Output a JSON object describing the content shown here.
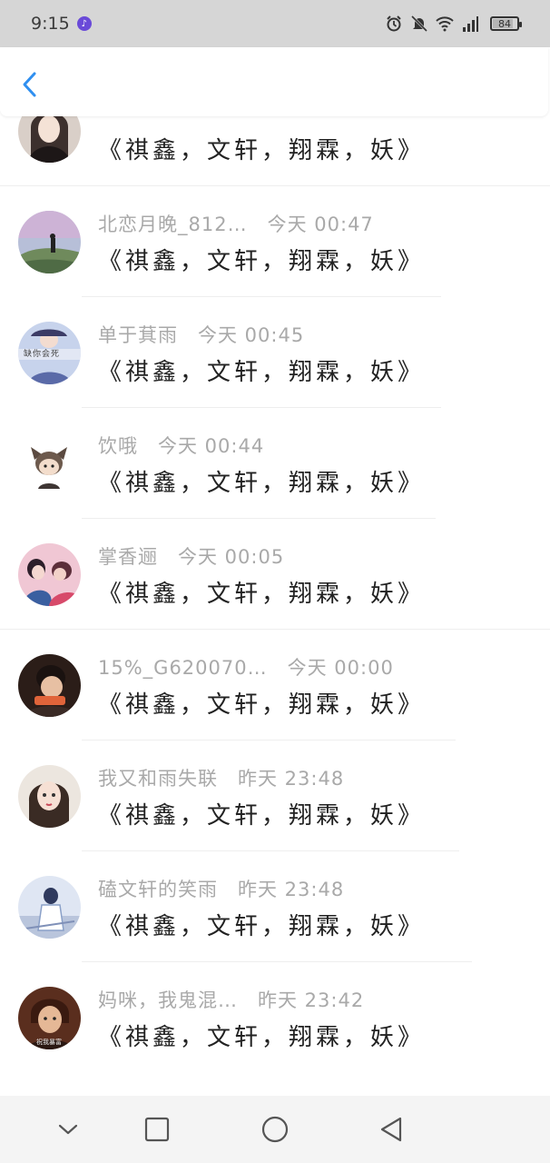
{
  "status_bar": {
    "time": "9:15",
    "battery": "84",
    "battery_level": 0.84,
    "icons": [
      "music-icon",
      "alarm-icon",
      "mute-icon",
      "wifi-icon",
      "signal-icon",
      "battery-icon"
    ]
  },
  "header": {
    "back_icon": "chevron-left-icon",
    "accent": "#2f8ff0"
  },
  "comments": [
    {
      "username": "",
      "time": "",
      "text": "《祺鑫，文轩，翔霖，妖》"
    },
    {
      "username": "北恋月晚_812…",
      "time": "今天 00:47",
      "text": "《祺鑫，文轩，翔霖，妖》"
    },
    {
      "username": "单于萁雨",
      "time": "今天 00:45",
      "text": "《祺鑫，文轩，翔霖，妖》"
    },
    {
      "username": "饮哦",
      "time": "今天 00:44",
      "text": "《祺鑫，文轩，翔霖，妖》"
    },
    {
      "username": "掌香逦",
      "time": "今天 00:05",
      "text": "《祺鑫，文轩，翔霖，妖》"
    },
    {
      "username": "15%_G620070…",
      "time": "今天 00:00",
      "text": "《祺鑫，文轩，翔霖，妖》"
    },
    {
      "username": "我又和雨失联",
      "time": "昨天 23:48",
      "text": "《祺鑫，文轩，翔霖，妖》"
    },
    {
      "username": "磕文轩的笑雨",
      "time": "昨天 23:48",
      "text": "《祺鑫，文轩，翔霖，妖》"
    },
    {
      "username": "妈咪，我鬼混…",
      "time": "昨天 23:42",
      "text": "《祺鑫，文轩，翔霖，妖》"
    }
  ],
  "avatar_images": {
    "avatar_3_caption": "缺你会死",
    "avatar_9_caption": "祝我暴富"
  },
  "nav_bar": {
    "icons": [
      "collapse-icon",
      "recent-apps-icon",
      "home-icon",
      "back-icon"
    ]
  }
}
